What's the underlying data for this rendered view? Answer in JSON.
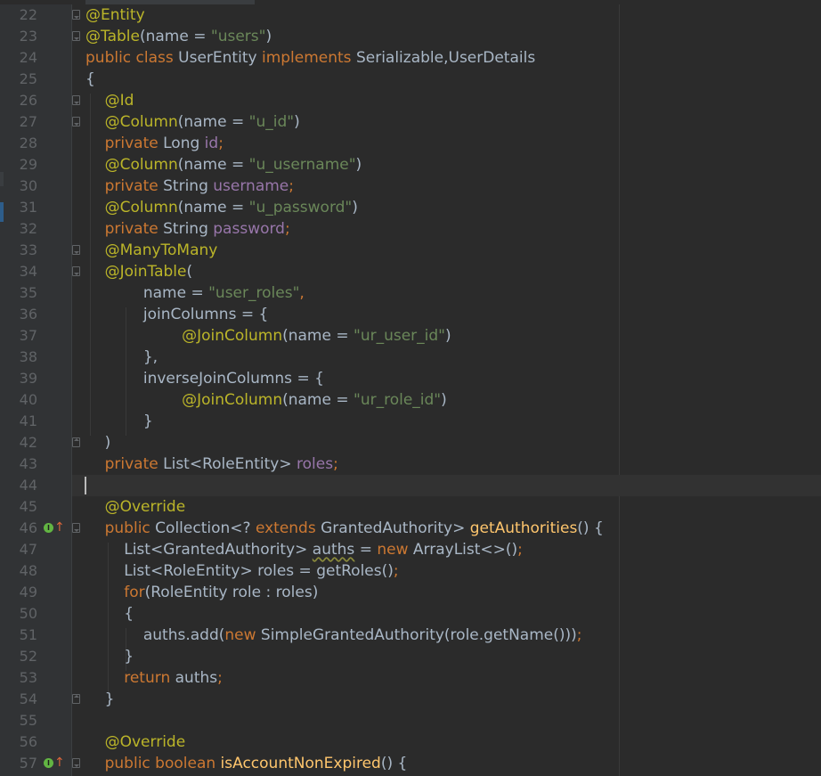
{
  "editor": {
    "colors": {
      "background": "#2b2b2b",
      "gutter": "#313335",
      "line_number": "#606366",
      "annotation": "#bbb529",
      "keyword": "#cc7832",
      "string": "#6a8759",
      "field": "#9876aa",
      "method": "#ffc66d",
      "text": "#a9b7c6",
      "override_icon": "#62b543"
    },
    "icons": [
      "fold-marker-icon",
      "override-method-icon",
      "up-arrow-icon"
    ],
    "lines": [
      {
        "num": "22",
        "tokens": [
          {
            "t": "@Entity",
            "c": "ann"
          }
        ]
      },
      {
        "num": "23",
        "tokens": [
          {
            "t": "@Table",
            "c": "ann"
          },
          {
            "t": "(name = ",
            "c": "plain"
          },
          {
            "t": "\"users\"",
            "c": "str"
          },
          {
            "t": ")",
            "c": "plain"
          }
        ]
      },
      {
        "num": "24",
        "tokens": [
          {
            "t": "public class ",
            "c": "kw"
          },
          {
            "t": "UserEntity ",
            "c": "plain"
          },
          {
            "t": "implements ",
            "c": "kw"
          },
          {
            "t": "Serializable,UserDetails",
            "c": "plain"
          }
        ]
      },
      {
        "num": "25",
        "tokens": [
          {
            "t": "{",
            "c": "plain"
          }
        ]
      },
      {
        "num": "26",
        "tokens": [
          {
            "t": "    @Id",
            "c": "ann"
          }
        ]
      },
      {
        "num": "27",
        "tokens": [
          {
            "t": "    @Column",
            "c": "ann"
          },
          {
            "t": "(name = ",
            "c": "plain"
          },
          {
            "t": "\"u_id\"",
            "c": "str"
          },
          {
            "t": ")",
            "c": "plain"
          }
        ]
      },
      {
        "num": "28",
        "tokens": [
          {
            "t": "    private ",
            "c": "kw"
          },
          {
            "t": "Long ",
            "c": "plain"
          },
          {
            "t": "id",
            "c": "fld"
          },
          {
            "t": ";",
            "c": "kw"
          }
        ]
      },
      {
        "num": "29",
        "tokens": [
          {
            "t": "    @Column",
            "c": "ann"
          },
          {
            "t": "(name = ",
            "c": "plain"
          },
          {
            "t": "\"u_username\"",
            "c": "str"
          },
          {
            "t": ")",
            "c": "plain"
          }
        ]
      },
      {
        "num": "30",
        "tokens": [
          {
            "t": "    private ",
            "c": "kw"
          },
          {
            "t": "String ",
            "c": "plain"
          },
          {
            "t": "username",
            "c": "fld"
          },
          {
            "t": ";",
            "c": "kw"
          }
        ]
      },
      {
        "num": "31",
        "tokens": [
          {
            "t": "    @Column",
            "c": "ann"
          },
          {
            "t": "(name = ",
            "c": "plain"
          },
          {
            "t": "\"u_password\"",
            "c": "str"
          },
          {
            "t": ")",
            "c": "plain"
          }
        ]
      },
      {
        "num": "32",
        "tokens": [
          {
            "t": "    private ",
            "c": "kw"
          },
          {
            "t": "String ",
            "c": "plain"
          },
          {
            "t": "password",
            "c": "fld"
          },
          {
            "t": ";",
            "c": "kw"
          }
        ]
      },
      {
        "num": "33",
        "tokens": [
          {
            "t": "    @ManyToMany",
            "c": "ann"
          }
        ]
      },
      {
        "num": "34",
        "tokens": [
          {
            "t": "    @JoinTable",
            "c": "ann"
          },
          {
            "t": "(",
            "c": "plain"
          }
        ]
      },
      {
        "num": "35",
        "tokens": [
          {
            "t": "            name = ",
            "c": "plain"
          },
          {
            "t": "\"user_roles\"",
            "c": "str"
          },
          {
            "t": ",",
            "c": "kw"
          }
        ]
      },
      {
        "num": "36",
        "tokens": [
          {
            "t": "            joinColumns = {",
            "c": "plain"
          }
        ]
      },
      {
        "num": "37",
        "tokens": [
          {
            "t": "                    @JoinColumn",
            "c": "ann"
          },
          {
            "t": "(name = ",
            "c": "plain"
          },
          {
            "t": "\"ur_user_id\"",
            "c": "str"
          },
          {
            "t": ")",
            "c": "plain"
          }
        ]
      },
      {
        "num": "38",
        "tokens": [
          {
            "t": "            },",
            "c": "plain"
          }
        ]
      },
      {
        "num": "39",
        "tokens": [
          {
            "t": "            inverseJoinColumns = {",
            "c": "plain"
          }
        ]
      },
      {
        "num": "40",
        "tokens": [
          {
            "t": "                    @JoinColumn",
            "c": "ann"
          },
          {
            "t": "(name = ",
            "c": "plain"
          },
          {
            "t": "\"ur_role_id\"",
            "c": "str"
          },
          {
            "t": ")",
            "c": "plain"
          }
        ]
      },
      {
        "num": "41",
        "tokens": [
          {
            "t": "            }",
            "c": "plain"
          }
        ]
      },
      {
        "num": "42",
        "tokens": [
          {
            "t": "    )",
            "c": "plain"
          }
        ]
      },
      {
        "num": "43",
        "tokens": [
          {
            "t": "    private ",
            "c": "kw"
          },
          {
            "t": "List<RoleEntity> ",
            "c": "plain"
          },
          {
            "t": "roles",
            "c": "fld"
          },
          {
            "t": ";",
            "c": "kw"
          }
        ]
      },
      {
        "num": "44",
        "tokens": []
      },
      {
        "num": "45",
        "tokens": [
          {
            "t": "    @Override",
            "c": "ann"
          }
        ]
      },
      {
        "num": "46",
        "tokens": [
          {
            "t": "    public ",
            "c": "kw"
          },
          {
            "t": "Collection<? ",
            "c": "plain"
          },
          {
            "t": "extends ",
            "c": "kw"
          },
          {
            "t": "GrantedAuthority> ",
            "c": "plain"
          },
          {
            "t": "getAuthorities",
            "c": "mth"
          },
          {
            "t": "() {",
            "c": "plain"
          }
        ]
      },
      {
        "num": "47",
        "tokens": [
          {
            "t": "        List<GrantedAuthority> ",
            "c": "plain"
          },
          {
            "t": "auths",
            "c": "plain warn"
          },
          {
            "t": " = ",
            "c": "plain"
          },
          {
            "t": "new ",
            "c": "kw"
          },
          {
            "t": "ArrayList<>()",
            "c": "plain"
          },
          {
            "t": ";",
            "c": "kw"
          }
        ]
      },
      {
        "num": "48",
        "tokens": [
          {
            "t": "        List<RoleEntity> roles = getRoles()",
            "c": "plain"
          },
          {
            "t": ";",
            "c": "kw"
          }
        ]
      },
      {
        "num": "49",
        "tokens": [
          {
            "t": "        ",
            "c": "plain"
          },
          {
            "t": "for",
            "c": "kw"
          },
          {
            "t": "(RoleEntity role : roles)",
            "c": "plain"
          }
        ]
      },
      {
        "num": "50",
        "tokens": [
          {
            "t": "        {",
            "c": "plain"
          }
        ]
      },
      {
        "num": "51",
        "tokens": [
          {
            "t": "            auths.add(",
            "c": "plain"
          },
          {
            "t": "new ",
            "c": "kw"
          },
          {
            "t": "SimpleGrantedAuthority(role.getName()))",
            "c": "plain"
          },
          {
            "t": ";",
            "c": "kw"
          }
        ]
      },
      {
        "num": "52",
        "tokens": [
          {
            "t": "        }",
            "c": "plain"
          }
        ]
      },
      {
        "num": "53",
        "tokens": [
          {
            "t": "        ",
            "c": "plain"
          },
          {
            "t": "return ",
            "c": "kw"
          },
          {
            "t": "auths",
            "c": "plain"
          },
          {
            "t": ";",
            "c": "kw"
          }
        ]
      },
      {
        "num": "54",
        "tokens": [
          {
            "t": "    }",
            "c": "plain"
          }
        ]
      },
      {
        "num": "55",
        "tokens": []
      },
      {
        "num": "56",
        "tokens": [
          {
            "t": "    @Override",
            "c": "ann"
          }
        ]
      },
      {
        "num": "57",
        "tokens": [
          {
            "t": "    public ",
            "c": "kw"
          },
          {
            "t": "boolean ",
            "c": "kw"
          },
          {
            "t": "isAccountNonExpired",
            "c": "mth"
          },
          {
            "t": "() {",
            "c": "plain"
          }
        ]
      }
    ]
  }
}
